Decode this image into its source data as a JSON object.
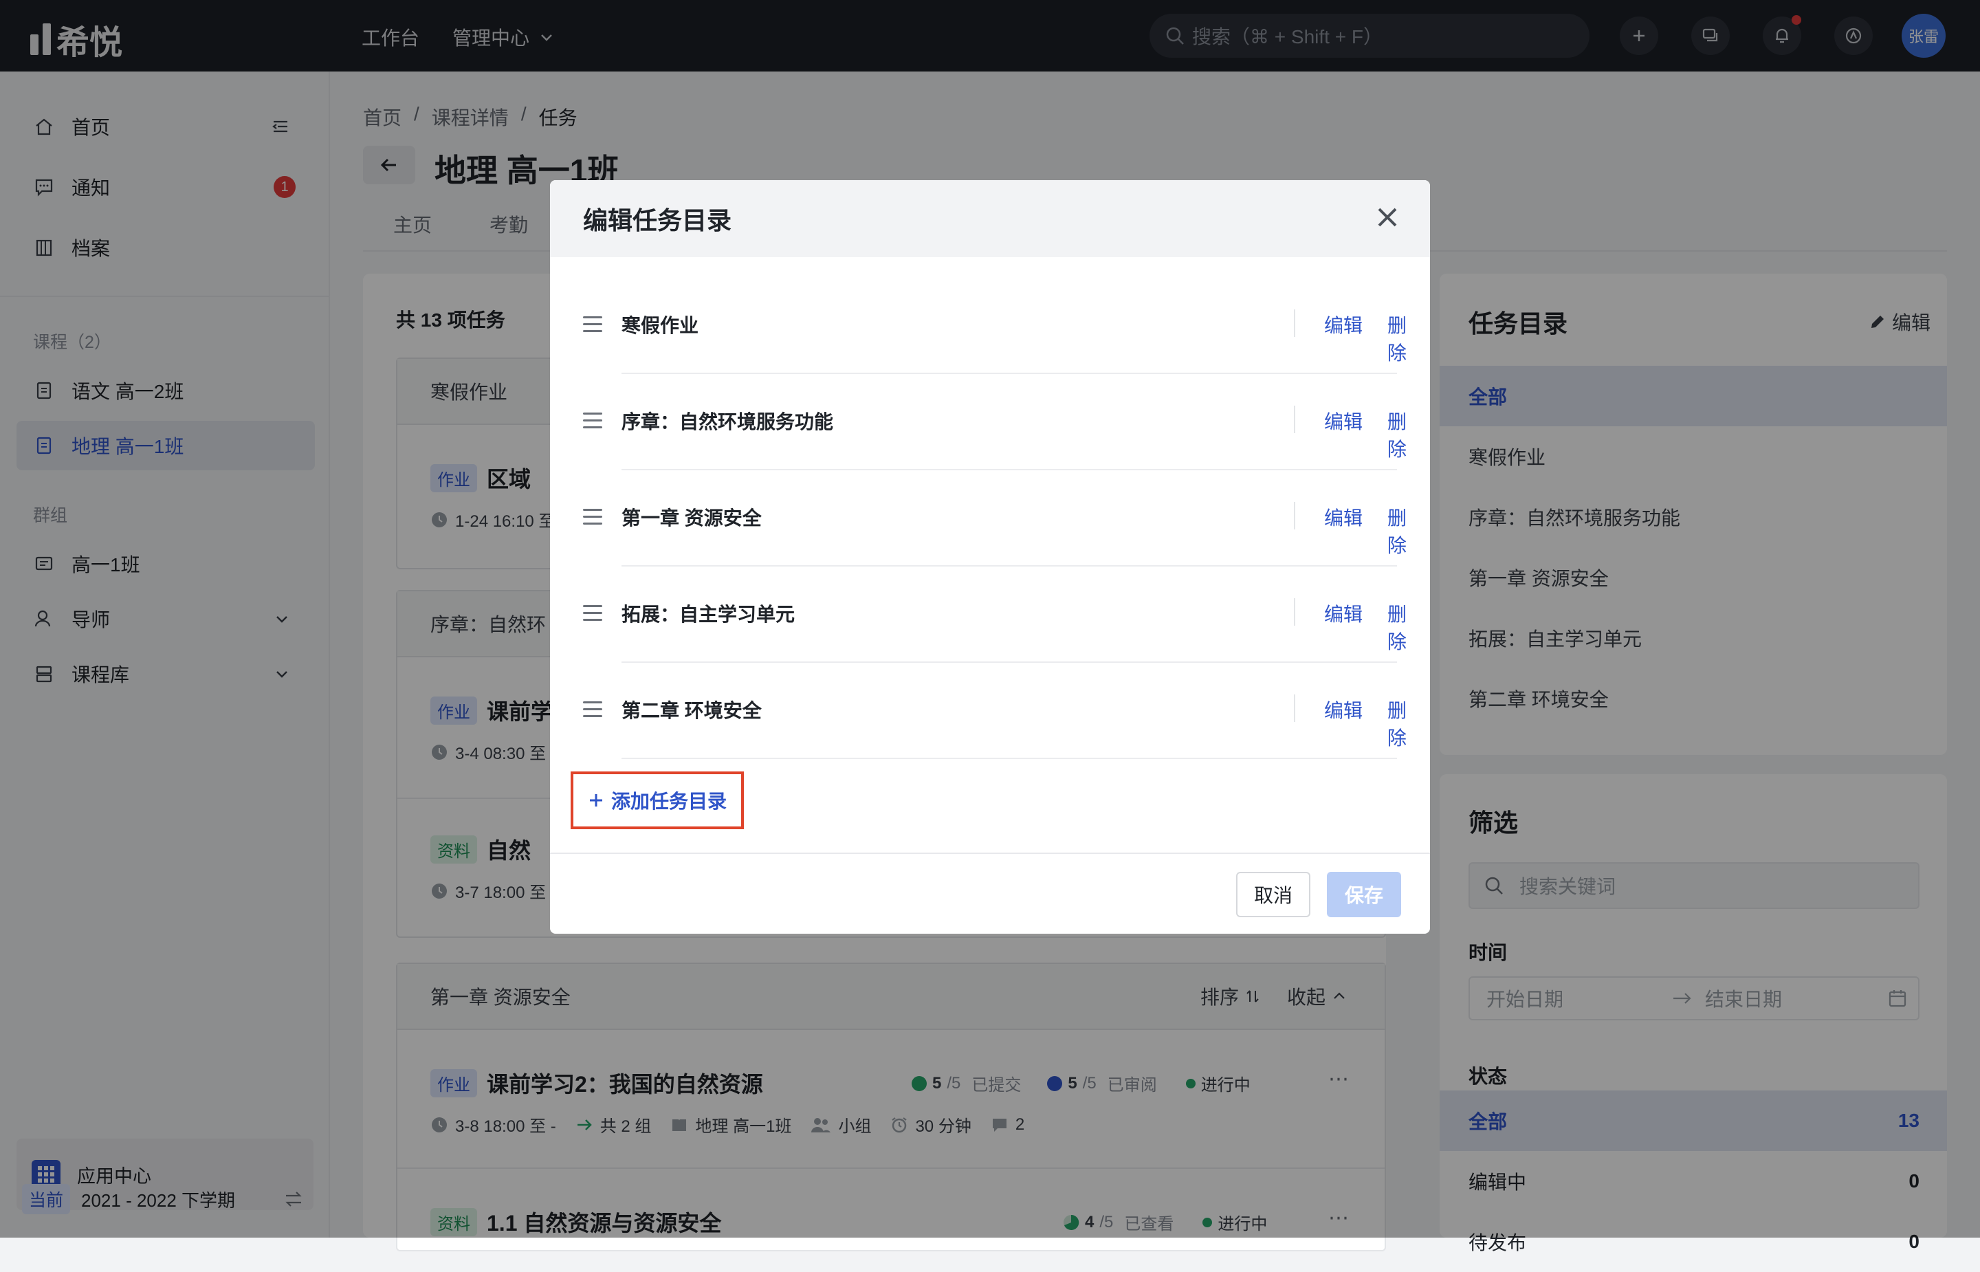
{
  "topbar": {
    "logo_text": "希悦",
    "nav": [
      "工作台",
      "管理中心"
    ],
    "search_placeholder": "搜索（⌘ + Shift + F）",
    "avatar_text": "张雷"
  },
  "sidebar": {
    "primary": [
      {
        "label": "首页",
        "icon": "home-icon"
      },
      {
        "label": "通知",
        "icon": "message-icon",
        "badge": "1"
      },
      {
        "label": "档案",
        "icon": "archive-icon"
      }
    ],
    "courses_heading": "课程（2）",
    "courses": [
      {
        "label": "语文 高一2班"
      },
      {
        "label": "地理 高一1班",
        "active": true
      }
    ],
    "groups_heading": "群组",
    "groups": [
      {
        "label": "高一1班"
      },
      {
        "label": "导师"
      },
      {
        "label": "课程库"
      }
    ],
    "app_center": "应用中心",
    "term_tag": "当前",
    "term": "2021 - 2022 下学期"
  },
  "main": {
    "breadcrumb": [
      "首页",
      "课程详情",
      "任务"
    ],
    "title": "地理 高一1班",
    "tabs": [
      "主页",
      "考勤"
    ],
    "task_count": "共 13 项任务",
    "groups": [
      {
        "head": "寒假作业",
        "tasks": [
          {
            "tag": "作业",
            "title": "区域",
            "time": "1-24 16:10 至"
          }
        ]
      },
      {
        "head": "序章：自然环",
        "tasks": [
          {
            "tag": "作业",
            "title": "课前学",
            "time": "3-4 08:30 至"
          },
          {
            "tag": "资料",
            "title": "自然",
            "time": "3-7 18:00 至"
          }
        ]
      },
      {
        "head": "第一章 资源安全",
        "sort": "排序",
        "collapse": "收起",
        "tasks": [
          {
            "tag": "作业",
            "title": "课前学习2：我国的自然资源",
            "submitted_num": "5",
            "submitted_den": "/5",
            "submitted_label": "已提交",
            "reviewed_num": "5",
            "reviewed_den": "/5",
            "reviewed_label": "已审阅",
            "status": "进行中",
            "time": "3-8 18:00 至 -",
            "groups": "共 2 组",
            "class": "地理 高一1班",
            "mode": "小组",
            "duration": "30 分钟",
            "comments": "2"
          },
          {
            "tag": "资料",
            "title": "1.1 自然资源与资源安全",
            "viewed_num": "4",
            "viewed_den": "/5",
            "viewed_label": "已查看",
            "status": "进行中"
          }
        ]
      }
    ]
  },
  "right_panel": {
    "catalog_title": "任务目录",
    "edit_label": "编辑",
    "catalog": [
      "全部",
      "寒假作业",
      "序章：自然环境服务功能",
      "第一章 资源安全",
      "拓展：自主学习单元",
      "第二章 环境安全"
    ],
    "filter_title": "筛选",
    "search_placeholder": "搜索关键词",
    "time_label": "时间",
    "start_placeholder": "开始日期",
    "end_placeholder": "结束日期",
    "status_label": "状态",
    "status": [
      {
        "label": "全部",
        "count": "13"
      },
      {
        "label": "编辑中",
        "count": "0"
      },
      {
        "label": "待发布",
        "count": "0"
      }
    ]
  },
  "modal": {
    "title": "编辑任务目录",
    "rows": [
      {
        "name": "寒假作业"
      },
      {
        "name": "序章：自然环境服务功能"
      },
      {
        "name": "第一章 资源安全"
      },
      {
        "name": "拓展：自主学习单元"
      },
      {
        "name": "第二章 环境安全"
      }
    ],
    "edit_label": "编辑",
    "delete_label": "删除",
    "add_label": "添加任务目录",
    "cancel_label": "取消",
    "save_label": "保存"
  },
  "colors": {
    "accent": "#2f54c8",
    "highlight_border": "#e0442a",
    "topbar": "#1c1f26"
  }
}
